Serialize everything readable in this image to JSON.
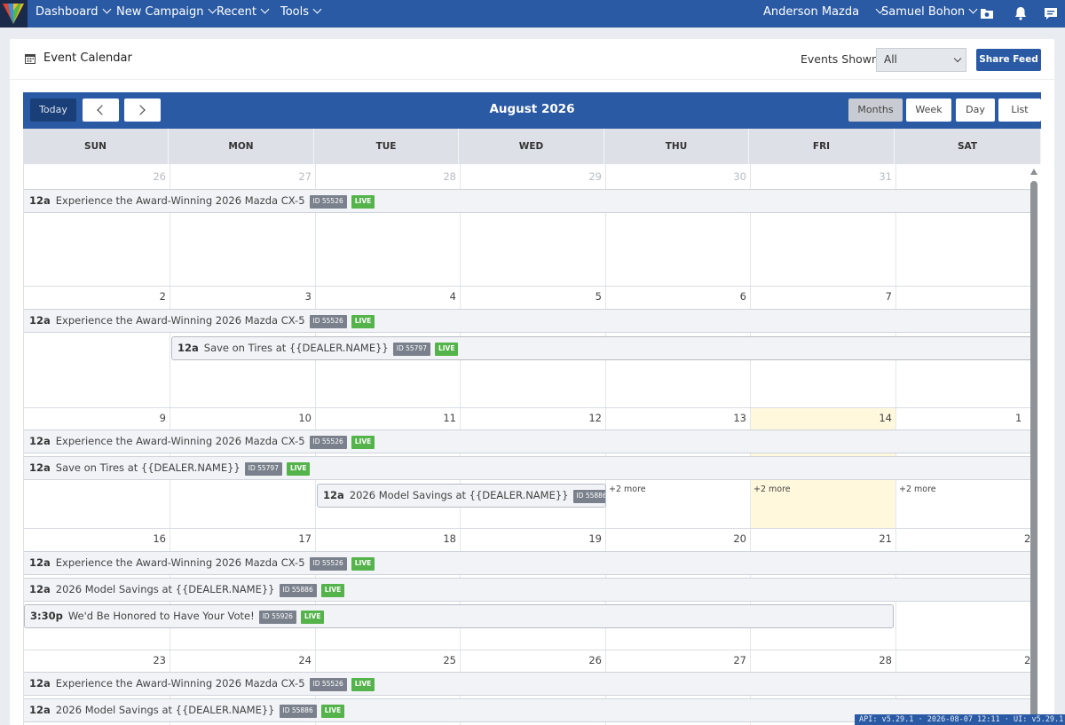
{
  "nav": {
    "items": [
      {
        "label": "Dashboard"
      },
      {
        "label": "New Campaign"
      },
      {
        "label": "Recent"
      },
      {
        "label": "Tools"
      }
    ],
    "account": "Anderson Mazda",
    "user": "Samuel Bohon",
    "icons": [
      "folder-camera-icon",
      "bell-icon",
      "message-icon"
    ]
  },
  "panel": {
    "title": "Event Calendar",
    "events_shown_label": "Events Shown:",
    "events_shown_value": "All",
    "share_feed": "Share Feed"
  },
  "calendar": {
    "today_label": "Today",
    "month_title": "August 2026",
    "views": [
      "Months",
      "Week",
      "Day",
      "List"
    ],
    "active_view": "Months",
    "weekdays": [
      "SUN",
      "MON",
      "TUE",
      "WED",
      "THU",
      "FRI",
      "SAT"
    ],
    "weeks": [
      {
        "days": [
          "26",
          "27",
          "28",
          "29",
          "30",
          "31",
          ""
        ]
      },
      {
        "days": [
          "2",
          "3",
          "4",
          "5",
          "6",
          "7",
          ""
        ]
      },
      {
        "days": [
          "9",
          "10",
          "11",
          "12",
          "13",
          "14",
          "1"
        ]
      },
      {
        "days": [
          "16",
          "17",
          "18",
          "19",
          "20",
          "21",
          "2"
        ]
      },
      {
        "days": [
          "23",
          "24",
          "25",
          "26",
          "27",
          "28",
          "2"
        ]
      }
    ],
    "events": [
      {
        "time": "12a",
        "title": "Experience the Award-Winning 2026 Mazda CX-5",
        "id": "ID 55526",
        "status": "LIVE"
      },
      {
        "time": "12a",
        "title": "Save on Tires at {{DEALER.NAME}}",
        "id": "ID 55797",
        "status": "LIVE"
      },
      {
        "time": "12a",
        "title": "2026 Model Savings at {{DEALER.NAME}}",
        "id": "ID 55886",
        "status": "LIVE"
      },
      {
        "time": "3:30p",
        "title": "We'd Be Honored to Have Your Vote!",
        "id": "ID 55926",
        "status": "LIVE"
      }
    ],
    "more_label": "+2 more"
  },
  "version_text": "API: v5.29.1 · 2026-08-07 12:11 · UI: v5.29.1"
}
